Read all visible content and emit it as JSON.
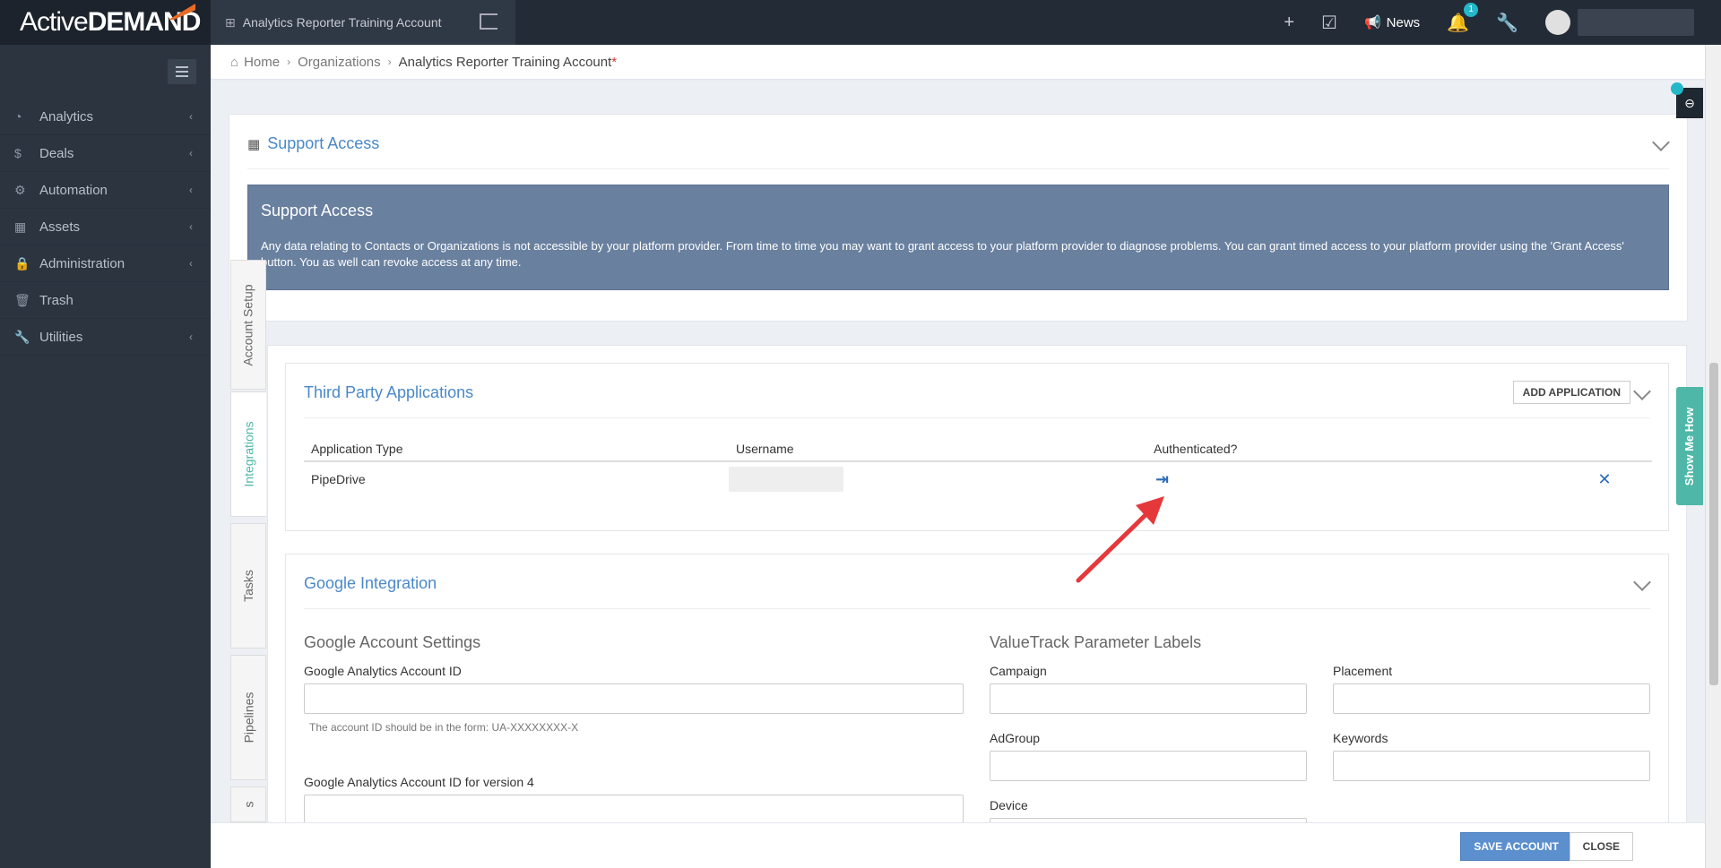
{
  "app": {
    "logo_part1": "Active",
    "logo_part2": "DEMAND",
    "account_name": "Analytics Reporter Training Account"
  },
  "topbar": {
    "news_label": "News",
    "notification_count": "1"
  },
  "sidebar": {
    "items": [
      {
        "label": "Analytics"
      },
      {
        "label": "Deals"
      },
      {
        "label": "Automation"
      },
      {
        "label": "Assets"
      },
      {
        "label": "Administration"
      },
      {
        "label": "Trash"
      },
      {
        "label": "Utilities"
      }
    ]
  },
  "breadcrumb": {
    "home": "Home",
    "organizations": "Organizations",
    "current": "Analytics Reporter Training Account",
    "required_mark": "*"
  },
  "vertical_tabs": [
    {
      "label": "Account Setup"
    },
    {
      "label": "Integrations"
    },
    {
      "label": "Tasks"
    },
    {
      "label": "Pipelines"
    },
    {
      "label": "s"
    }
  ],
  "support_access": {
    "title": "Support Access",
    "box_title": "Support Access",
    "box_text": "Any data relating to Contacts or Organizations is not accessible by your platform provider. From time to time you may want to grant access to your platform provider to diagnose problems. You can grant timed access to your platform provider using the 'Grant Access' button. You as well can revoke access at any time."
  },
  "third_party": {
    "title": "Third Party Applications",
    "add_button": "ADD APPLICATION",
    "headers": [
      "Application Type",
      "Username",
      "Authenticated?"
    ],
    "rows": [
      {
        "application_type": "PipeDrive"
      }
    ]
  },
  "google": {
    "title": "Google Integration",
    "account_settings_heading": "Google Account Settings",
    "ga_id_label": "Google Analytics Account ID",
    "ga_id_value": "",
    "ga_id_help": "The account ID should be in the form: UA-XXXXXXXX-X",
    "ga4_id_label": "Google Analytics Account ID for version 4",
    "ga4_id_value": "",
    "valuetrack_heading": "ValueTrack Parameter Labels",
    "campaign_label": "Campaign",
    "placement_label": "Placement",
    "adgroup_label": "AdGroup",
    "keywords_label": "Keywords",
    "device_label": "Device"
  },
  "widgets": {
    "show_me_how": "Show Me How"
  },
  "footer": {
    "save_label": "SAVE ACCOUNT",
    "close_label": "CLOSE"
  },
  "colors": {
    "topbar": "#232b36",
    "sidebar": "#2c3440",
    "accent_blue": "#4a89c8",
    "info_box": "#69809f",
    "teal": "#4fb7a7",
    "save_button": "#5b8fce",
    "arrow": "#e5383b"
  }
}
